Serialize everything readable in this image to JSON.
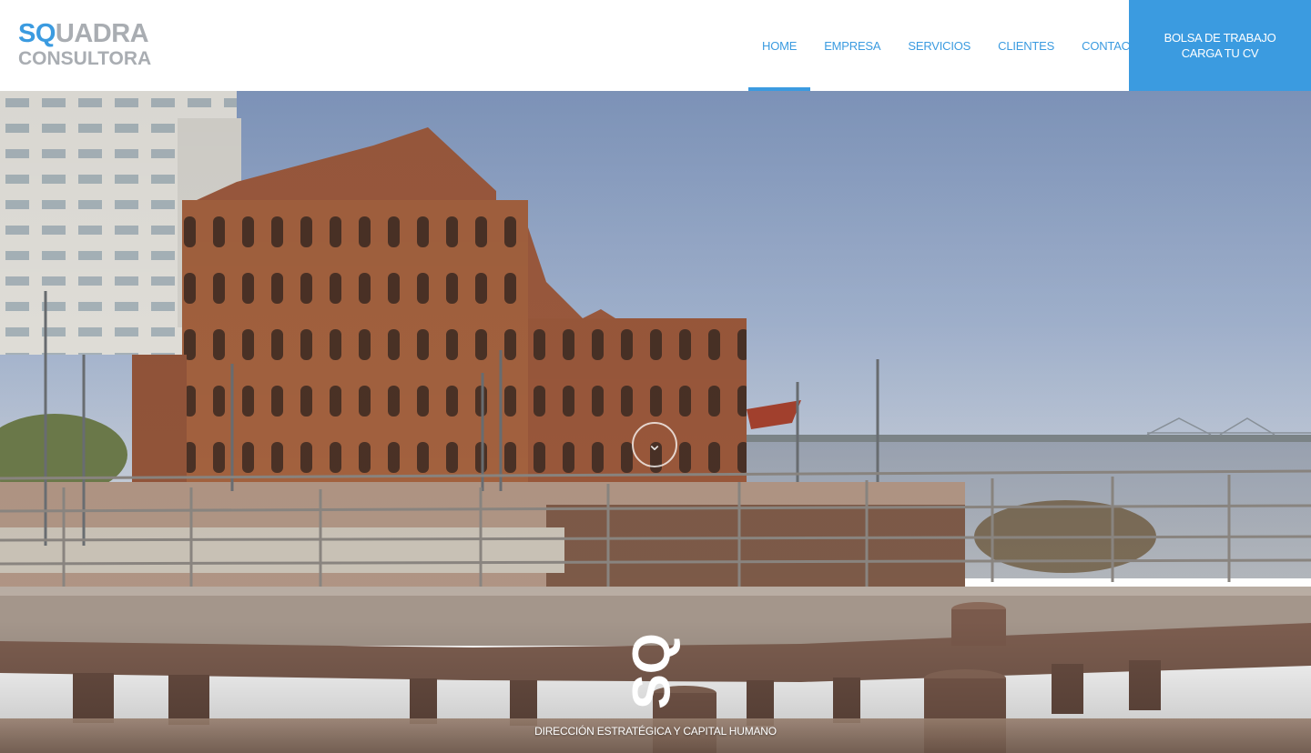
{
  "header": {
    "logo": {
      "line1_highlight": "SQ",
      "line1_rest": "UADRA",
      "line2": "CONSULTORA"
    },
    "nav": [
      {
        "label": "HOME",
        "active": true
      },
      {
        "label": "EMPRESA",
        "active": false
      },
      {
        "label": "SERVICIOS",
        "active": false
      },
      {
        "label": "CLIENTES",
        "active": false
      },
      {
        "label": "CONTACTO",
        "active": false
      }
    ],
    "cta": {
      "line1": "BOLSA DE TRABAJO",
      "line2": "CARGA TU CV"
    }
  },
  "hero": {
    "scroll_icon": "chevron-down-icon",
    "mark_text": "SQ",
    "tagline": "DIRECCIÓN ESTRATÉGICA Y CAPITAL HUMANO"
  },
  "colors": {
    "accent": "#3b9be0",
    "logo_gray": "#a9adb2",
    "sky": "#8fa6c8",
    "brick": "#9a5a3c",
    "water": "#a8b0bc"
  }
}
